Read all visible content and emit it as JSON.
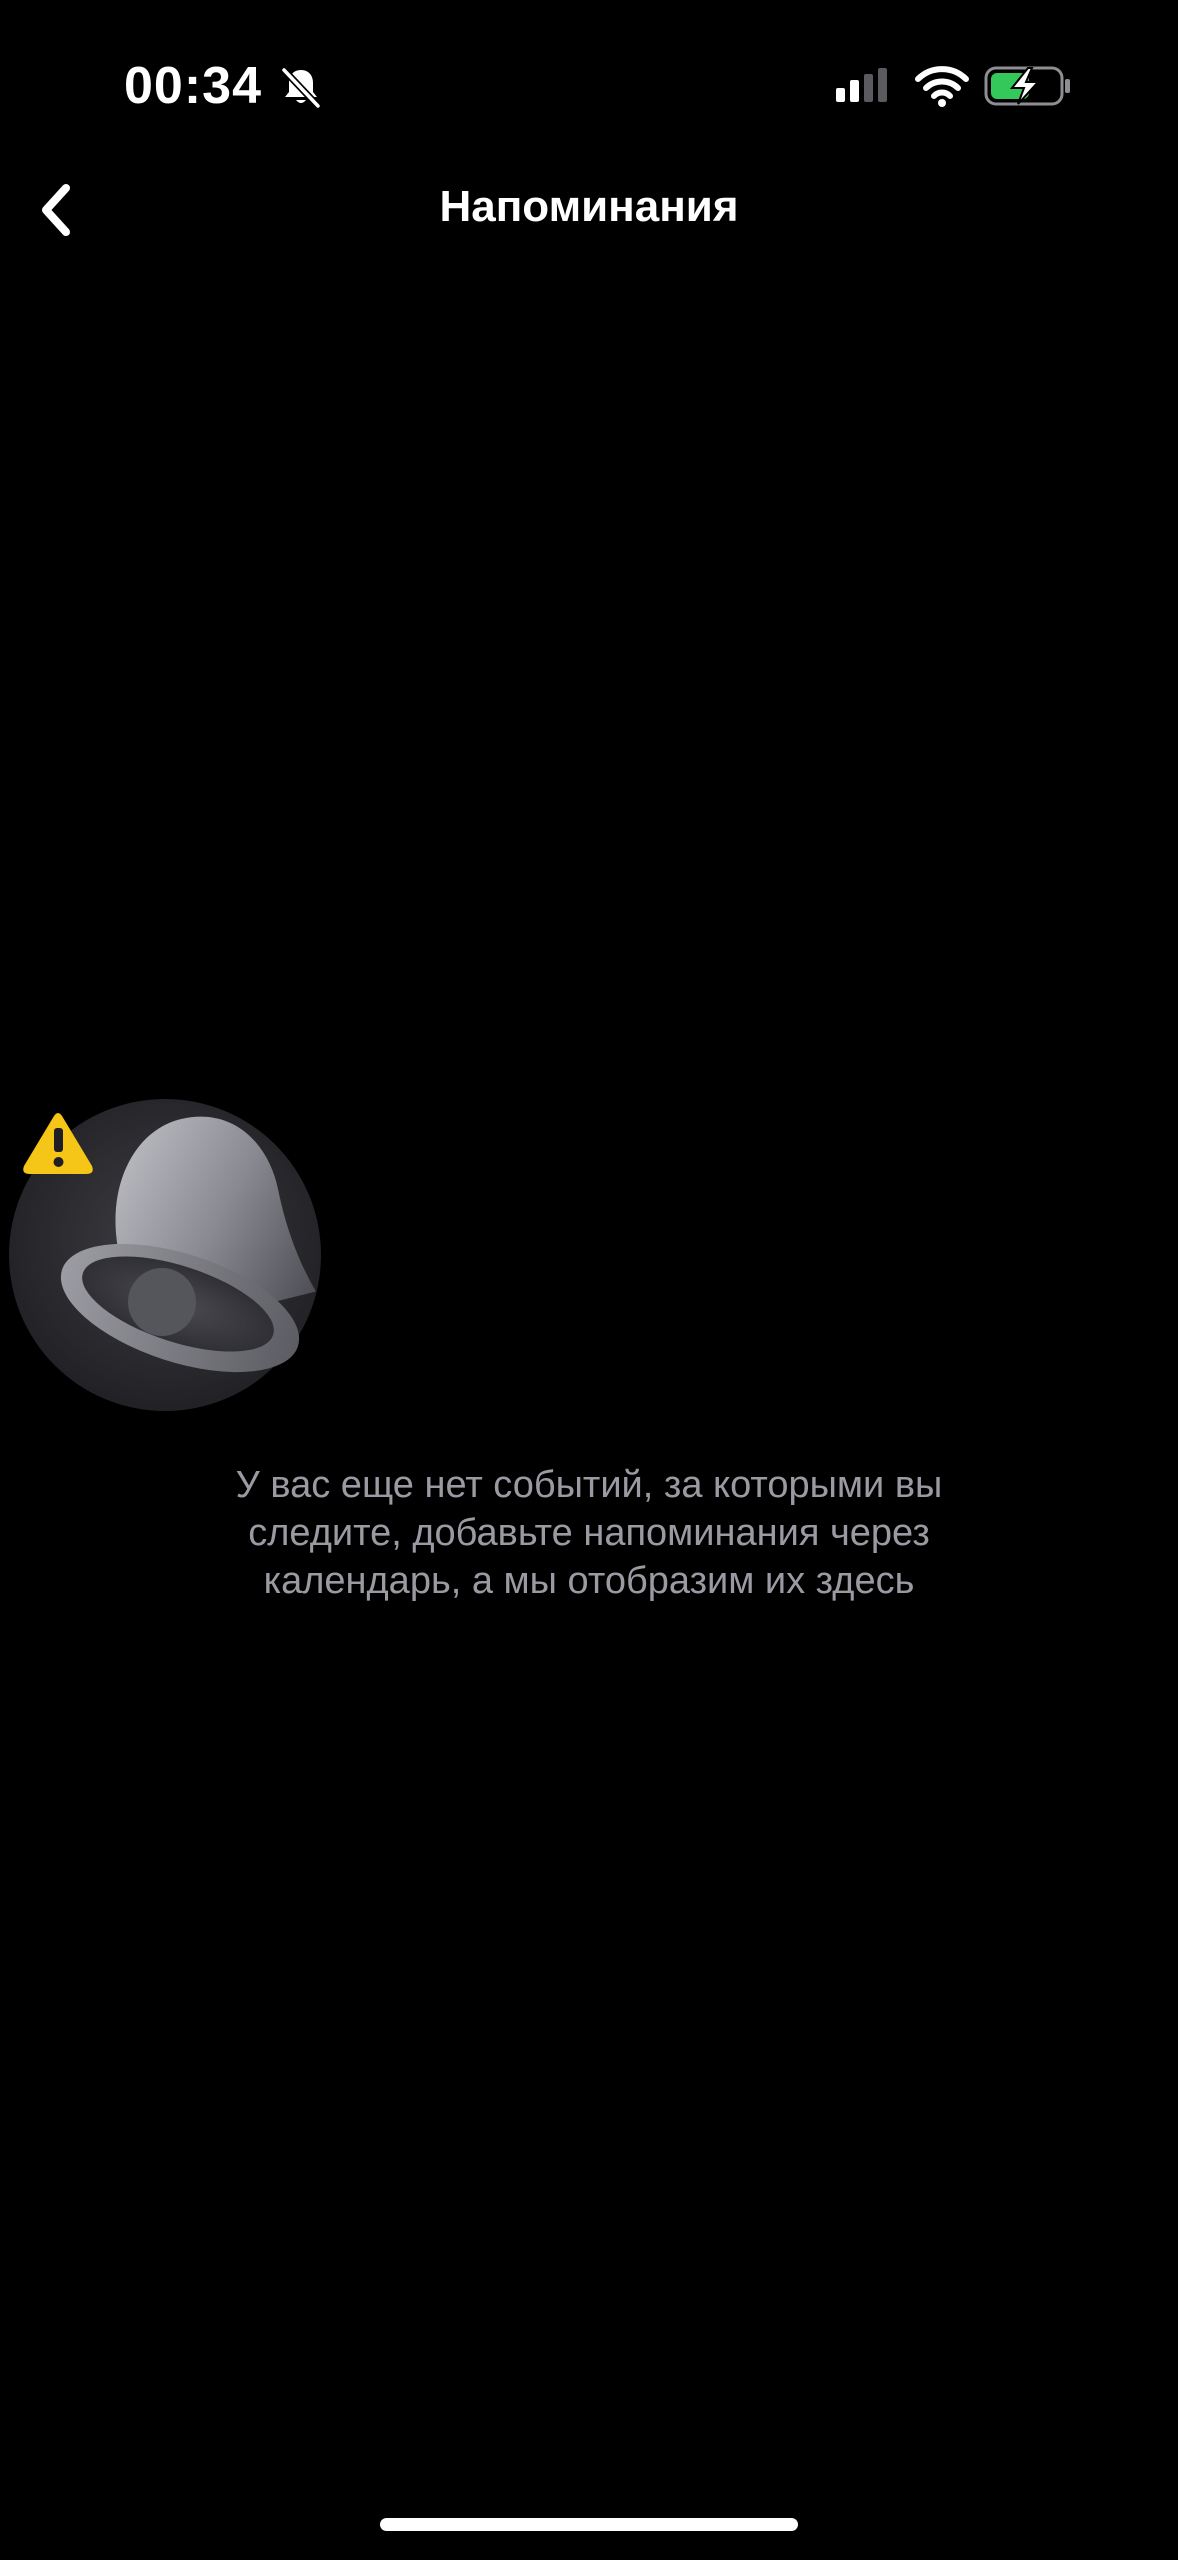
{
  "status_bar": {
    "time": "00:34",
    "mute_icon": "bell-slash-icon",
    "signal_icon": "cellular-signal-icon",
    "wifi_icon": "wifi-icon",
    "battery_icon": "battery-charging-icon",
    "battery_color": "#34c759"
  },
  "header": {
    "back_icon": "chevron-left-icon",
    "title": "Напоминания"
  },
  "empty_state": {
    "icon": "bell-icon",
    "badge_icon": "warning-triangle-icon",
    "badge_color": "#f5c518",
    "message": "У вас еще нет событий, за которыми вы следите, добавьте напоминания через календарь, а мы отобразим их здесь"
  },
  "colors": {
    "background": "#000000",
    "title": "#ffffff",
    "message": "#9a9aa3"
  }
}
